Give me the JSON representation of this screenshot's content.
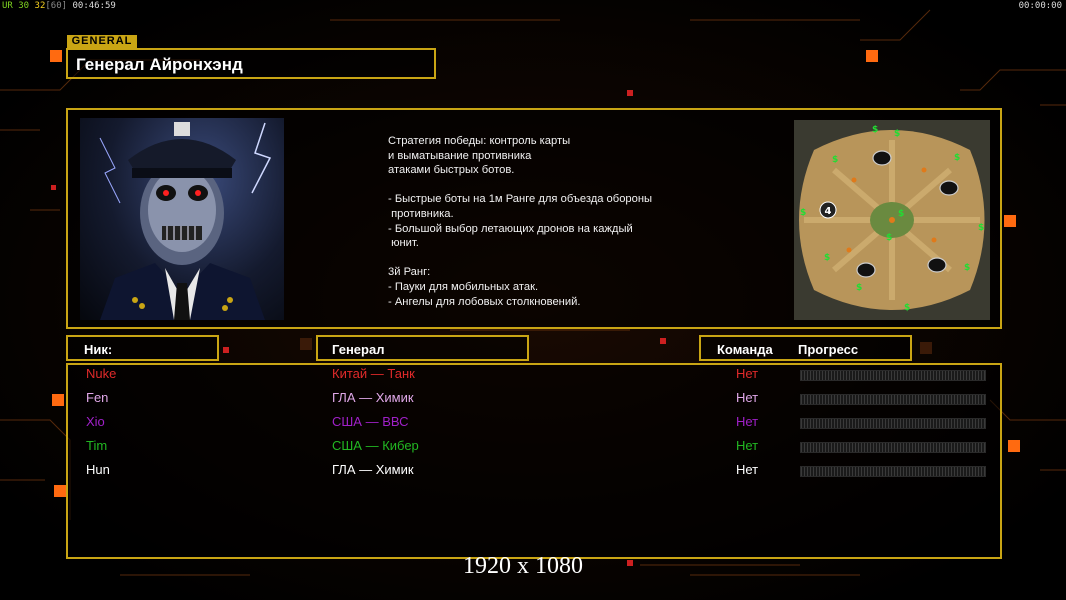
{
  "hud": {
    "ver": "UR",
    "fps_a": "30",
    "fps_b": "32",
    "fps_max": "[60]",
    "elapsed": "00:46:59",
    "timer": "00:00:00"
  },
  "general": {
    "tag": "GENERAL",
    "name": "Генерал Айронхэнд",
    "strategy": "Стратегия победы: контроль карты\nи выматывание противника\nатаками быстрых ботов.\n\n- Быстрые боты на 1м Ранге для объезда обороны\n противника.\n- Большой выбор летающих дронов на каждый\n юнит.\n\n3й Ранг:\n- Пауки для мобильных атак.\n- Ангелы для лобовых столкновений."
  },
  "minimap": {
    "player_marker": "4"
  },
  "table": {
    "headers": {
      "nick": "Ник:",
      "general": "Генерал",
      "team": "Команда",
      "progress": "Прогресс"
    },
    "rows": [
      {
        "nick": "Nuke",
        "general": "Китай — Танк",
        "team": "Нет",
        "color": "#e02a2a",
        "progress": 0
      },
      {
        "nick": "Fen",
        "general": "ГЛА — Химик",
        "team": "Нет",
        "color": "#e0a8e8",
        "progress": 0
      },
      {
        "nick": "Xio",
        "general": "США — ВВС",
        "team": "Нет",
        "color": "#a020c8",
        "progress": 0
      },
      {
        "nick": "Tim",
        "general": "США — Кибер",
        "team": "Нет",
        "color": "#22b822",
        "progress": 0
      },
      {
        "nick": "Hun",
        "general": "ГЛА — Химик",
        "team": "Нет",
        "color": "#ffffff",
        "progress": 0
      }
    ]
  },
  "resolution": "1920 x 1080",
  "colors": {
    "frame": "#c9a514",
    "accent_orange": "#ff6a10"
  }
}
